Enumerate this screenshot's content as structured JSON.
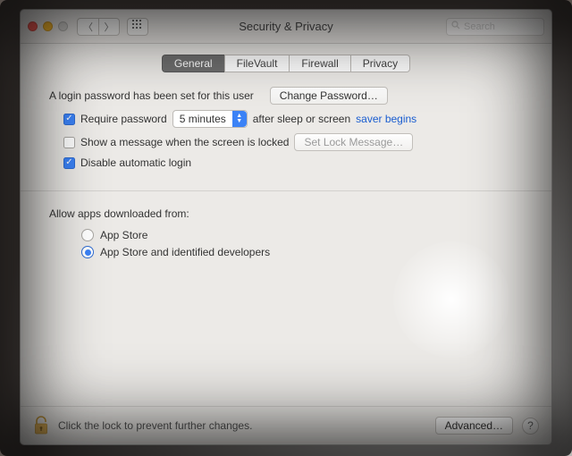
{
  "window": {
    "title": "Security & Privacy"
  },
  "search": {
    "placeholder": "Search"
  },
  "tabs": [
    {
      "label": "General",
      "active": true
    },
    {
      "label": "FileVault",
      "active": false
    },
    {
      "label": "Firewall",
      "active": false
    },
    {
      "label": "Privacy",
      "active": false
    }
  ],
  "login": {
    "password_set_text": "A login password has been set for this user",
    "change_password_btn": "Change Password…",
    "require_password_label": "Require password",
    "require_password_checked": true,
    "delay_selected": "5 minutes",
    "after_sleep_text_a": "after sleep or screen",
    "after_sleep_text_b": "saver begins",
    "show_message_label": "Show a message when the screen is locked",
    "show_message_checked": false,
    "set_lock_message_btn": "Set Lock Message…",
    "disable_auto_login_label": "Disable automatic login",
    "disable_auto_login_checked": true
  },
  "apps": {
    "heading": "Allow apps downloaded from:",
    "options": [
      {
        "label": "App Store",
        "selected": false
      },
      {
        "label": "App Store and identified developers",
        "selected": true
      }
    ]
  },
  "footer": {
    "lock_text": "Click the lock to prevent further changes.",
    "advanced_btn": "Advanced…"
  }
}
